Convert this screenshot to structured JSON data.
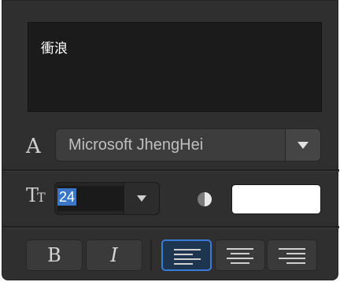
{
  "text_box": {
    "value": "衝浪"
  },
  "font": {
    "icon": "font-icon",
    "family_label": "Microsoft JhengHei",
    "dropdown_icon": "chevron-down-icon"
  },
  "size": {
    "icon": "text-size-icon",
    "value": "24",
    "dropdown_icon": "chevron-down-icon"
  },
  "color": {
    "icon": "color-wheel-icon",
    "swatch": "#ffffff"
  },
  "style_buttons": {
    "bold_label": "B",
    "italic_label": "I"
  },
  "alignment": {
    "selected": "left",
    "icons": [
      "align-left-icon",
      "align-center-icon",
      "align-right-icon"
    ]
  }
}
